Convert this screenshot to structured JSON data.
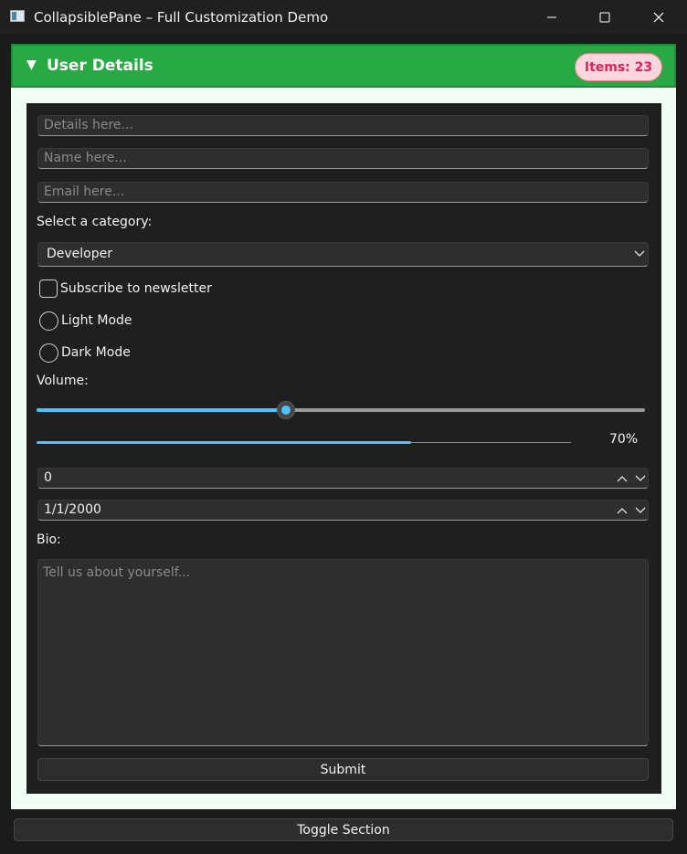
{
  "window": {
    "title": "CollapsiblePane – Full Customization Demo"
  },
  "pane": {
    "arrow": "▼",
    "title": "User Details",
    "badge": "Items: 23",
    "colors": {
      "header": "#27a944",
      "badge_text": "#e0245e",
      "accent": "#4cc2ff"
    }
  },
  "form": {
    "details_placeholder": "Details here...",
    "name_placeholder": "Name here...",
    "email_placeholder": "Email here...",
    "category_label": "Select a category:",
    "category_value": "Developer",
    "newsletter_label": "Subscribe to newsletter",
    "newsletter_checked": false,
    "radio_light_label": "Light Mode",
    "radio_dark_label": "Dark Mode",
    "volume_label": "Volume:",
    "volume_fraction": 0.41,
    "progress_text": "70%",
    "progress_value": 70,
    "spin_value": "0",
    "date_value": "1/1/2000",
    "bio_label": "Bio:",
    "bio_placeholder": "Tell us about yourself...",
    "submit_label": "Submit"
  },
  "footer": {
    "toggle_label": "Toggle Section"
  },
  "icons": [
    "app-icon",
    "minimize-icon",
    "maximize-icon",
    "close-icon",
    "expand-arrow-icon",
    "chevron-down-icon",
    "chevron-up-icon"
  ]
}
